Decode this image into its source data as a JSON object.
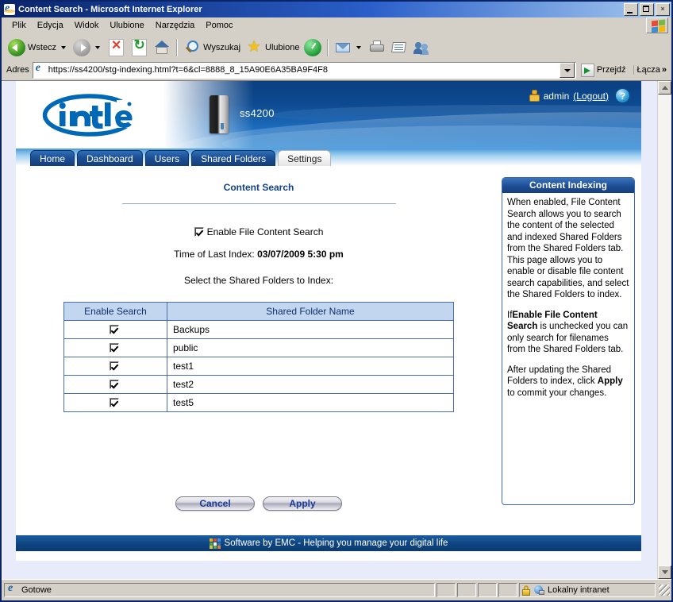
{
  "window": {
    "title": "Content Search - Microsoft Internet Explorer",
    "minimize_label": "",
    "maximize_label": "",
    "close_label": "×"
  },
  "menubar": {
    "items": [
      {
        "label": "Plik"
      },
      {
        "label": "Edycja"
      },
      {
        "label": "Widok"
      },
      {
        "label": "Ulubione"
      },
      {
        "label": "Narzędzia"
      },
      {
        "label": "Pomoc"
      }
    ]
  },
  "toolbar": {
    "back_label": "Wstecz",
    "forward_label": "",
    "stop_label": "",
    "refresh_label": "",
    "home_label": "",
    "search_label": "Wyszukaj",
    "favorites_label": "Ulubione",
    "history_label": "",
    "mail_label": "",
    "print_label": "",
    "edit_label": "",
    "messenger_label": ""
  },
  "address": {
    "label": "Adres",
    "url": "https://ss4200/stg-indexing.html?t=6&cl=8888_8_15A90E6A35BA9F4F8",
    "go_label": "Przejdź",
    "links_label": "Łącza",
    "links_chevron": "»"
  },
  "banner": {
    "brand": "intel",
    "device_name": "ss4200",
    "user_name": "admin",
    "logout_label": "(Logout)",
    "help_label": "?"
  },
  "tabs": [
    {
      "label": "Home",
      "active": false
    },
    {
      "label": "Dashboard",
      "active": false
    },
    {
      "label": "Users",
      "active": false
    },
    {
      "label": "Shared Folders",
      "active": false
    },
    {
      "label": "Settings",
      "active": true
    }
  ],
  "main": {
    "page_title": "Content Search",
    "enable_checkbox_label": "Enable File Content Search",
    "enable_checkbox_checked": true,
    "last_index_label": "Time of Last Index:",
    "last_index_value": "03/07/2009 5:30 pm",
    "select_folders_label": "Select the Shared Folders to Index:",
    "table": {
      "headers": [
        "Enable Search",
        "Shared Folder Name"
      ],
      "rows": [
        {
          "checked": true,
          "name": "Backups"
        },
        {
          "checked": true,
          "name": "public"
        },
        {
          "checked": true,
          "name": "test1"
        },
        {
          "checked": true,
          "name": "test2"
        },
        {
          "checked": true,
          "name": "test5"
        }
      ]
    },
    "cancel_label": "Cancel",
    "apply_label": "Apply"
  },
  "help": {
    "title": "Content Indexing",
    "paragraph1": "When enabled, File Content Search allows you to search the content of the selected and indexed Shared Folders from the Shared Folders tab. This page allows you to enable or disable file content search capabilities, and select the Shared Folders to index.",
    "paragraph2_pre": "If",
    "paragraph2_bold": "Enable File Content Search",
    "paragraph2_post": " is unchecked you can only search for filenames from the Shared Folders tab.",
    "paragraph3_pre": "After updating the Shared Folders to index, click ",
    "paragraph3_bold": "Apply",
    "paragraph3_post": " to commit your changes."
  },
  "footer": {
    "text": "Software by EMC - Helping you manage your digital life"
  },
  "statusbar": {
    "status_text": "Gotowe",
    "zone_text": "Lokalny intranet"
  },
  "colors": {
    "brand_blue": "#0b3f80",
    "intel_blue": "#0068b5",
    "tab_blue": "#1d4f93",
    "heading_blue": "#11418a",
    "table_header_bg": "#c3d6ef",
    "table_border": "#4a6fa5",
    "footer_blue": "#0f4480",
    "page_bg": "#e7ebfa"
  }
}
